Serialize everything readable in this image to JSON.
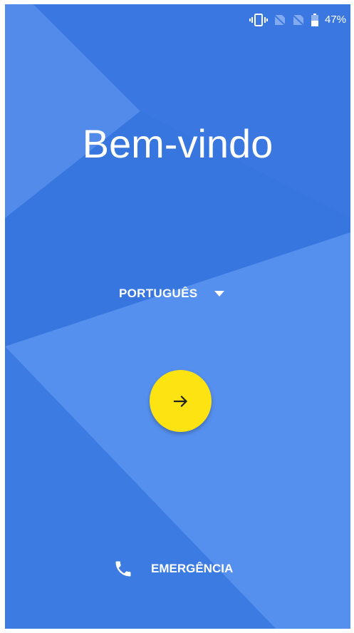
{
  "status_bar": {
    "icons": [
      "vibrate-icon",
      "no-sim-icon",
      "no-sim-icon",
      "battery-icon"
    ],
    "battery_percent": "47%"
  },
  "welcome": {
    "title": "Bem-vindo"
  },
  "language": {
    "selected": "PORTUGUÊS",
    "icon": "dropdown-caret-icon"
  },
  "next_button": {
    "icon": "arrow-right-icon",
    "color": "#fde311"
  },
  "emergency": {
    "label": "EMERGÊNCIA",
    "icon": "phone-icon"
  },
  "colors": {
    "background": "#3a79e0",
    "accent": "#fde311",
    "text": "#ffffff"
  }
}
